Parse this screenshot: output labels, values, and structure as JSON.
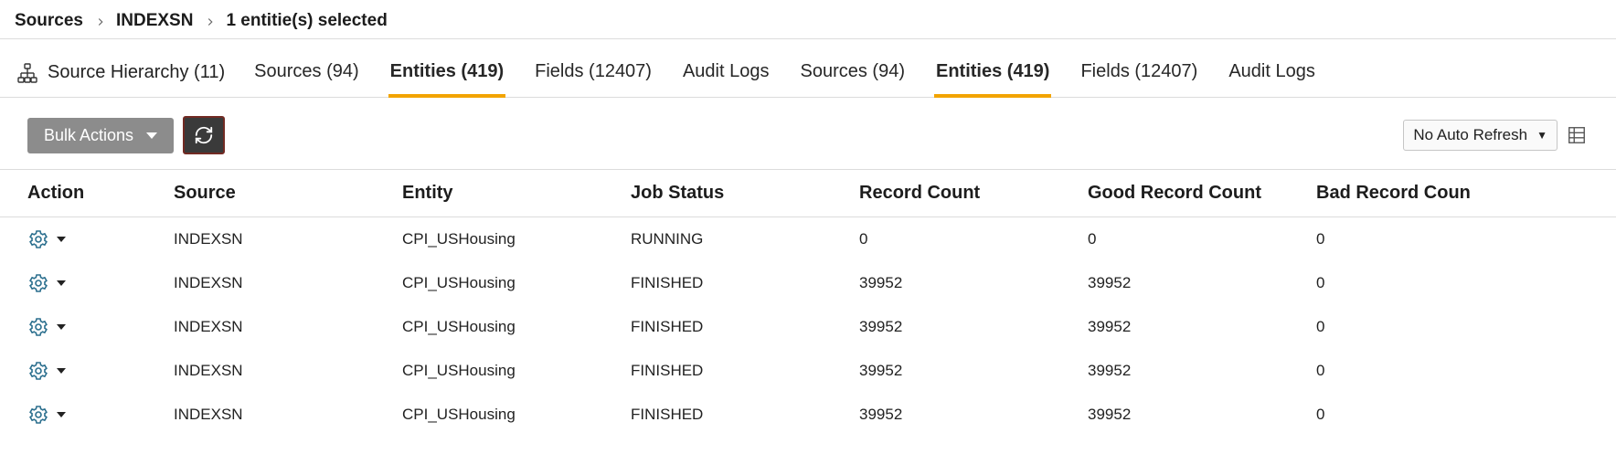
{
  "breadcrumb": {
    "a": "Sources",
    "b": "INDEXSN",
    "c": "1 entitie(s) selected"
  },
  "hierarchy_label": "Source Hierarchy (11)",
  "tabs": [
    {
      "label": "Sources (94)",
      "active": false
    },
    {
      "label": "Entities (419)",
      "active": true
    },
    {
      "label": "Fields (12407)",
      "active": false
    },
    {
      "label": "Audit Logs",
      "active": false
    }
  ],
  "toolbar": {
    "bulk_label": "Bulk Actions",
    "auto_refresh_selected": "No Auto Refresh"
  },
  "table": {
    "headers": [
      "Action",
      "Source",
      "Entity",
      "Job Status",
      "Record Count",
      "Good Record Count",
      "Bad Record Coun"
    ],
    "rows": [
      {
        "source": "INDEXSN",
        "entity": "CPI_USHousing",
        "job_status": "RUNNING",
        "record_count": "0",
        "good": "0",
        "bad": "0"
      },
      {
        "source": "INDEXSN",
        "entity": "CPI_USHousing",
        "job_status": "FINISHED",
        "record_count": "39952",
        "good": "39952",
        "bad": "0"
      },
      {
        "source": "INDEXSN",
        "entity": "CPI_USHousing",
        "job_status": "FINISHED",
        "record_count": "39952",
        "good": "39952",
        "bad": "0"
      },
      {
        "source": "INDEXSN",
        "entity": "CPI_USHousing",
        "job_status": "FINISHED",
        "record_count": "39952",
        "good": "39952",
        "bad": "0"
      },
      {
        "source": "INDEXSN",
        "entity": "CPI_USHousing",
        "job_status": "FINISHED",
        "record_count": "39952",
        "good": "39952",
        "bad": "0"
      }
    ]
  }
}
